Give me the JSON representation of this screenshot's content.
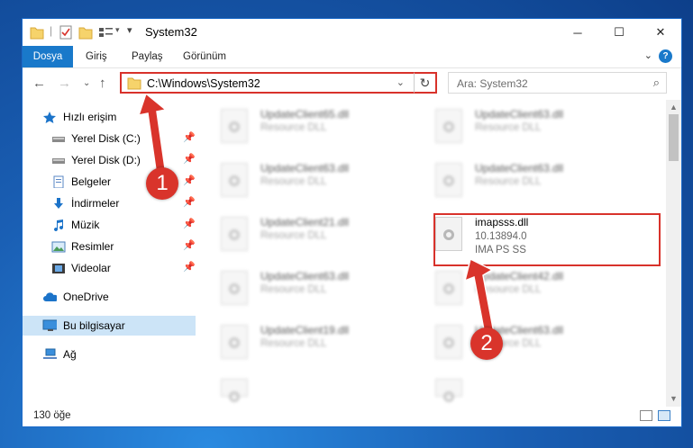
{
  "window": {
    "title": "System32",
    "controls": {
      "minimize": "─",
      "maximize": "☐",
      "close": "✕"
    }
  },
  "ribbon": {
    "tabs": [
      "Dosya",
      "Giriş",
      "Paylaş",
      "Görünüm"
    ]
  },
  "address": {
    "path": "C:\\Windows\\System32",
    "search_placeholder": "Ara: System32"
  },
  "nav": {
    "items": [
      {
        "label": "Hızlı erişim",
        "icon": "star-icon",
        "pinned": false
      },
      {
        "label": "Yerel Disk (C:)",
        "icon": "drive-icon",
        "pinned": true
      },
      {
        "label": "Yerel Disk (D:)",
        "icon": "drive-icon",
        "pinned": true
      },
      {
        "label": "Belgeler",
        "icon": "documents-icon",
        "pinned": true
      },
      {
        "label": "İndirmeler",
        "icon": "download-icon",
        "pinned": true
      },
      {
        "label": "Müzik",
        "icon": "music-icon",
        "pinned": true
      },
      {
        "label": "Resimler",
        "icon": "pictures-icon",
        "pinned": true
      },
      {
        "label": "Videolar",
        "icon": "videos-icon",
        "pinned": true
      },
      {
        "label": "OneDrive",
        "icon": "cloud-icon",
        "pinned": false
      },
      {
        "label": "Bu bilgisayar",
        "icon": "computer-icon",
        "pinned": false,
        "selected": true
      },
      {
        "label": "Ağ",
        "icon": "network-icon",
        "pinned": false
      }
    ]
  },
  "files": {
    "blurred": [
      {
        "name": "UpdateClient65.dll",
        "type": "Resource DLL"
      },
      {
        "name": "UpdateClient63.dll",
        "type": "Resource DLL"
      },
      {
        "name": "UpdateClient63.dll",
        "type": "Resource DLL"
      },
      {
        "name": "UpdateClient63.dll",
        "type": "Resource DLL"
      },
      {
        "name": "UpdateClient21.dll",
        "type": "Resource DLL"
      },
      {
        "name": "UpdateClient63.dll",
        "type": "Resource DLL"
      },
      {
        "name": "UpdateClient42.dll",
        "type": "Resource DLL"
      },
      {
        "name": "UpdateClient19.dll",
        "type": "Resource DLL"
      },
      {
        "name": "UpdateClient63.dll",
        "type": "Resource DLL"
      }
    ],
    "highlighted": {
      "name": "imapsss.dll",
      "version": "10.13894.0",
      "description": "IMA PS SS"
    }
  },
  "status": {
    "count": "130 öğe"
  },
  "callouts": {
    "first": "1",
    "second": "2",
    "color": "#d9342b"
  }
}
